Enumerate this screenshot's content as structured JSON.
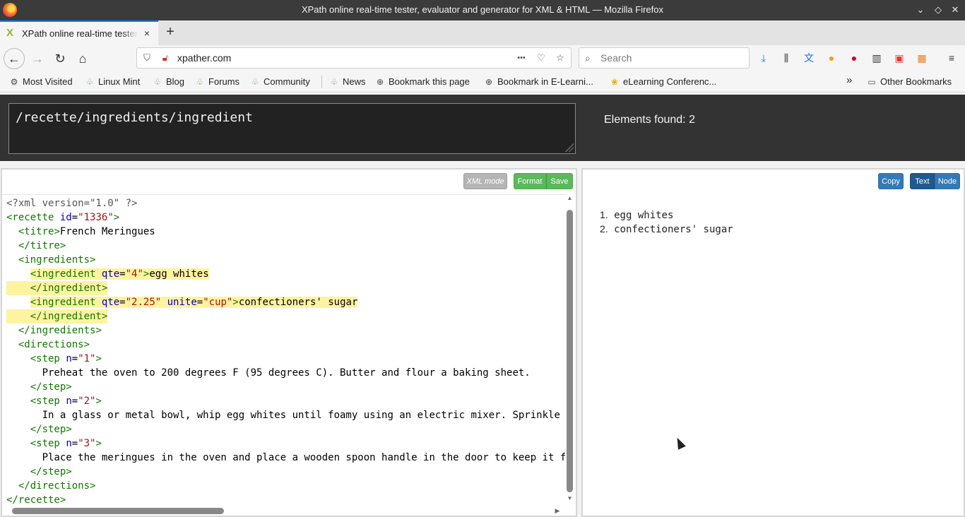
{
  "window": {
    "title": "XPath online real-time tester, evaluator and generator for XML & HTML — Mozilla Firefox"
  },
  "tab": {
    "title": "XPath online real-time tester, evaluator and generator for XML & HTML",
    "close": "×",
    "new_tab": "+"
  },
  "nav": {
    "url": "xpather.com",
    "search_placeholder": "Search",
    "page_actions": "•••"
  },
  "bookmarks": {
    "items": [
      "Most Visited",
      "Linux Mint",
      "Blog",
      "Forums",
      "Community",
      "News",
      "Bookmark this page",
      "Bookmark in E-Learni...",
      "eLearning Conferenc..."
    ],
    "overflow": "»",
    "other": "Other Bookmarks"
  },
  "query": {
    "value": "/recette/ingredients/ingredient",
    "found_label": "Elements found: 2"
  },
  "editor": {
    "buttons": {
      "mode": "XML mode",
      "format": "Format",
      "save": "Save"
    },
    "lines": [
      "<?xml version=\"1.0\" ?>",
      "<recette id=\"1336\">",
      "  <titre>French Meringues",
      "  </titre>",
      "  <ingredients>",
      "    <ingredient qte=\"4\">egg whites",
      "    </ingredient>",
      "    <ingredient qte=\"2.25\" unite=\"cup\">confectioners' sugar",
      "    </ingredient>",
      "  </ingredients>",
      "  <directions>",
      "    <step n=\"1\">",
      "      Preheat the oven to 200 degrees F (95 degrees C). Butter and flour a baking sheet.",
      "    </step>",
      "    <step n=\"2\">",
      "      In a glass or metal bowl, whip egg whites until foamy using an electric mixer. Sprinkle in",
      "    </step>",
      "    <step n=\"3\">",
      "      Place the meringues in the oven and place a wooden spoon handle in the door to keep it fro",
      "    </step>",
      "  </directions>",
      "</recette>"
    ]
  },
  "results": {
    "buttons": {
      "copy": "Copy",
      "text": "Text",
      "node": "Node"
    },
    "items": [
      {
        "num": "1.",
        "text": "egg whites"
      },
      {
        "num": "2.",
        "text": "confectioners' sugar"
      }
    ]
  }
}
